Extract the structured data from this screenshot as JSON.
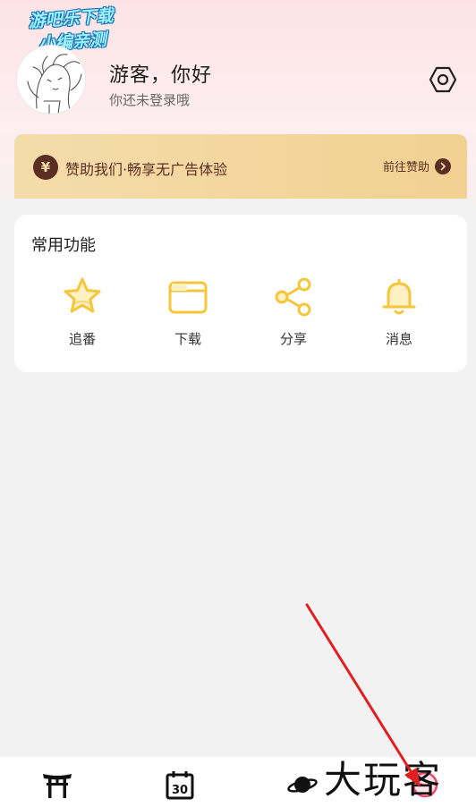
{
  "watermark": {
    "line1": "游吧乐下载",
    "line2": "小编亲测"
  },
  "profile": {
    "greeting": "游客，你好",
    "subtitle": "你还未登录哦"
  },
  "sponsor": {
    "coin_symbol": "¥",
    "text": "赞助我们·畅享无广告体验",
    "link_label": "前往赞助"
  },
  "features_card": {
    "title": "常用功能",
    "items": [
      {
        "label": "追番",
        "icon": "star-icon"
      },
      {
        "label": "下载",
        "icon": "folder-icon"
      },
      {
        "label": "分享",
        "icon": "share-icon"
      },
      {
        "label": "消息",
        "icon": "bell-icon"
      }
    ]
  },
  "bottom_nav": {
    "items": [
      {
        "icon": "torii-gate-icon"
      },
      {
        "icon": "calendar-icon",
        "calendar_day": "30"
      },
      {
        "icon": "planet-icon"
      },
      {
        "icon": "profile-icon"
      }
    ]
  },
  "brand_watermark": "大玩客",
  "colors": {
    "accent": "#f5c63a",
    "sponsor_dark": "#5a2e22",
    "annotation_arrow": "#e02020"
  }
}
